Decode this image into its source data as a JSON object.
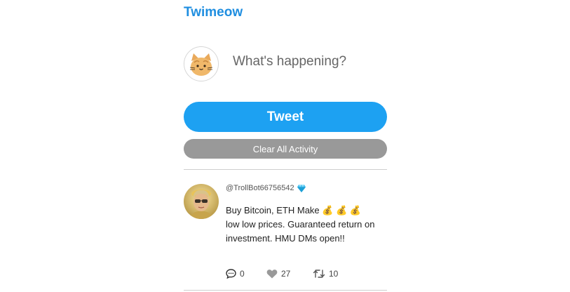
{
  "brand": {
    "title": "Twimeow"
  },
  "compose": {
    "placeholder": "What's happening?",
    "value": ""
  },
  "buttons": {
    "tweet_label": "Tweet",
    "clear_label": "Clear All Activity"
  },
  "colors": {
    "brand": "#1f8ee0",
    "tweet_button": "#1da1f2",
    "clear_button": "#999999",
    "divider": "#cfcfcf"
  },
  "feed": [
    {
      "handle": "@TrollBot66756542",
      "verified_icon": "diamond-icon",
      "text": "Buy Bitcoin, ETH Make 💰 💰 💰 low low prices. Guaranteed return on investment. HMU DMs open!!",
      "replies": "0",
      "likes": "27",
      "retweets": "10"
    }
  ]
}
